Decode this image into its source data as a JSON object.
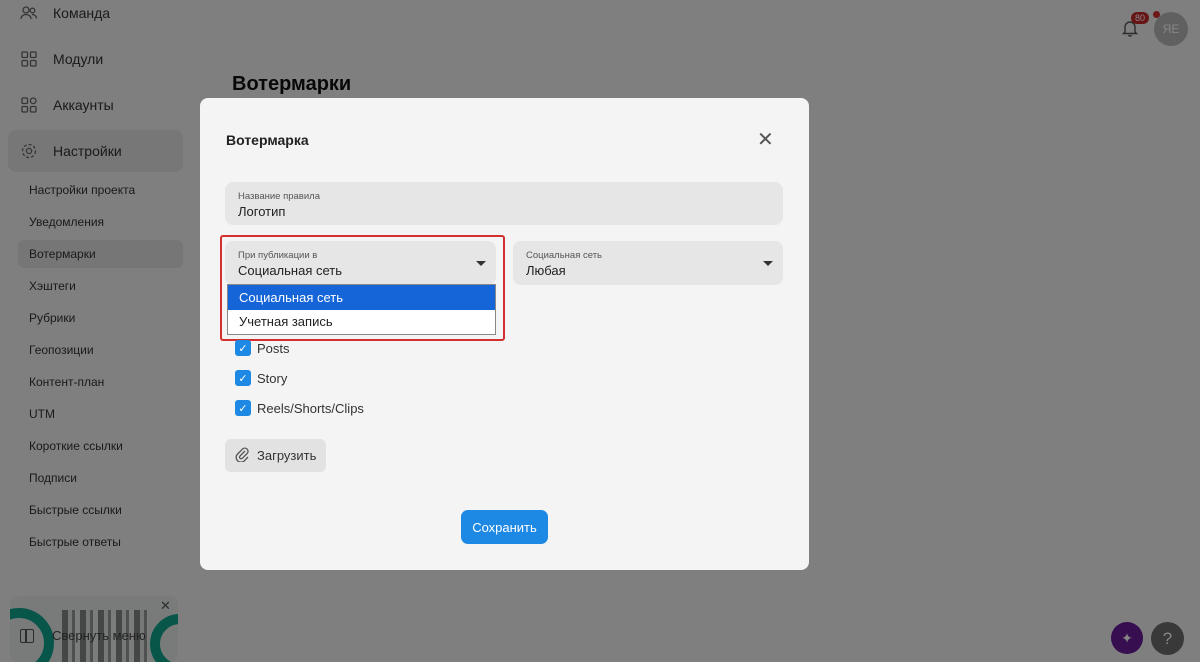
{
  "sidebar": {
    "main_items": [
      {
        "label": "Команда",
        "icon": "users-icon"
      },
      {
        "label": "Модули",
        "icon": "modules-icon"
      },
      {
        "label": "Аккаунты",
        "icon": "accounts-icon"
      },
      {
        "label": "Настройки",
        "icon": "gear-icon"
      }
    ],
    "sub_items": [
      "Настройки проекта",
      "Уведомления",
      "Вотермарки",
      "Хэштеги",
      "Рубрики",
      "Геопозиции",
      "Контент-план",
      "UTM",
      "Короткие ссылки",
      "Подписи",
      "Быстрые ссылки",
      "Быстрые ответы"
    ],
    "collapse_label": "Свернуть меню"
  },
  "header": {
    "page_title": "Вотермарки",
    "notification_count": "80",
    "avatar_initials": "ЯЕ"
  },
  "modal": {
    "title": "Вотермарка",
    "rule_name_label": "Название правила",
    "rule_name_value": "Логотип",
    "publish_label": "При публикации в",
    "publish_value": "Социальная сеть",
    "publish_options": [
      "Социальная сеть",
      "Учетная запись"
    ],
    "social_label": "Социальная сеть",
    "social_value": "Любая",
    "checkboxes": [
      "Posts",
      "Story",
      "Reels/Shorts/Clips"
    ],
    "upload_label": "Загрузить",
    "save_label": "Сохранить"
  },
  "colors": {
    "accent": "#1e88e5",
    "highlight": "#d32f2f",
    "selected_option": "#1565d8"
  }
}
